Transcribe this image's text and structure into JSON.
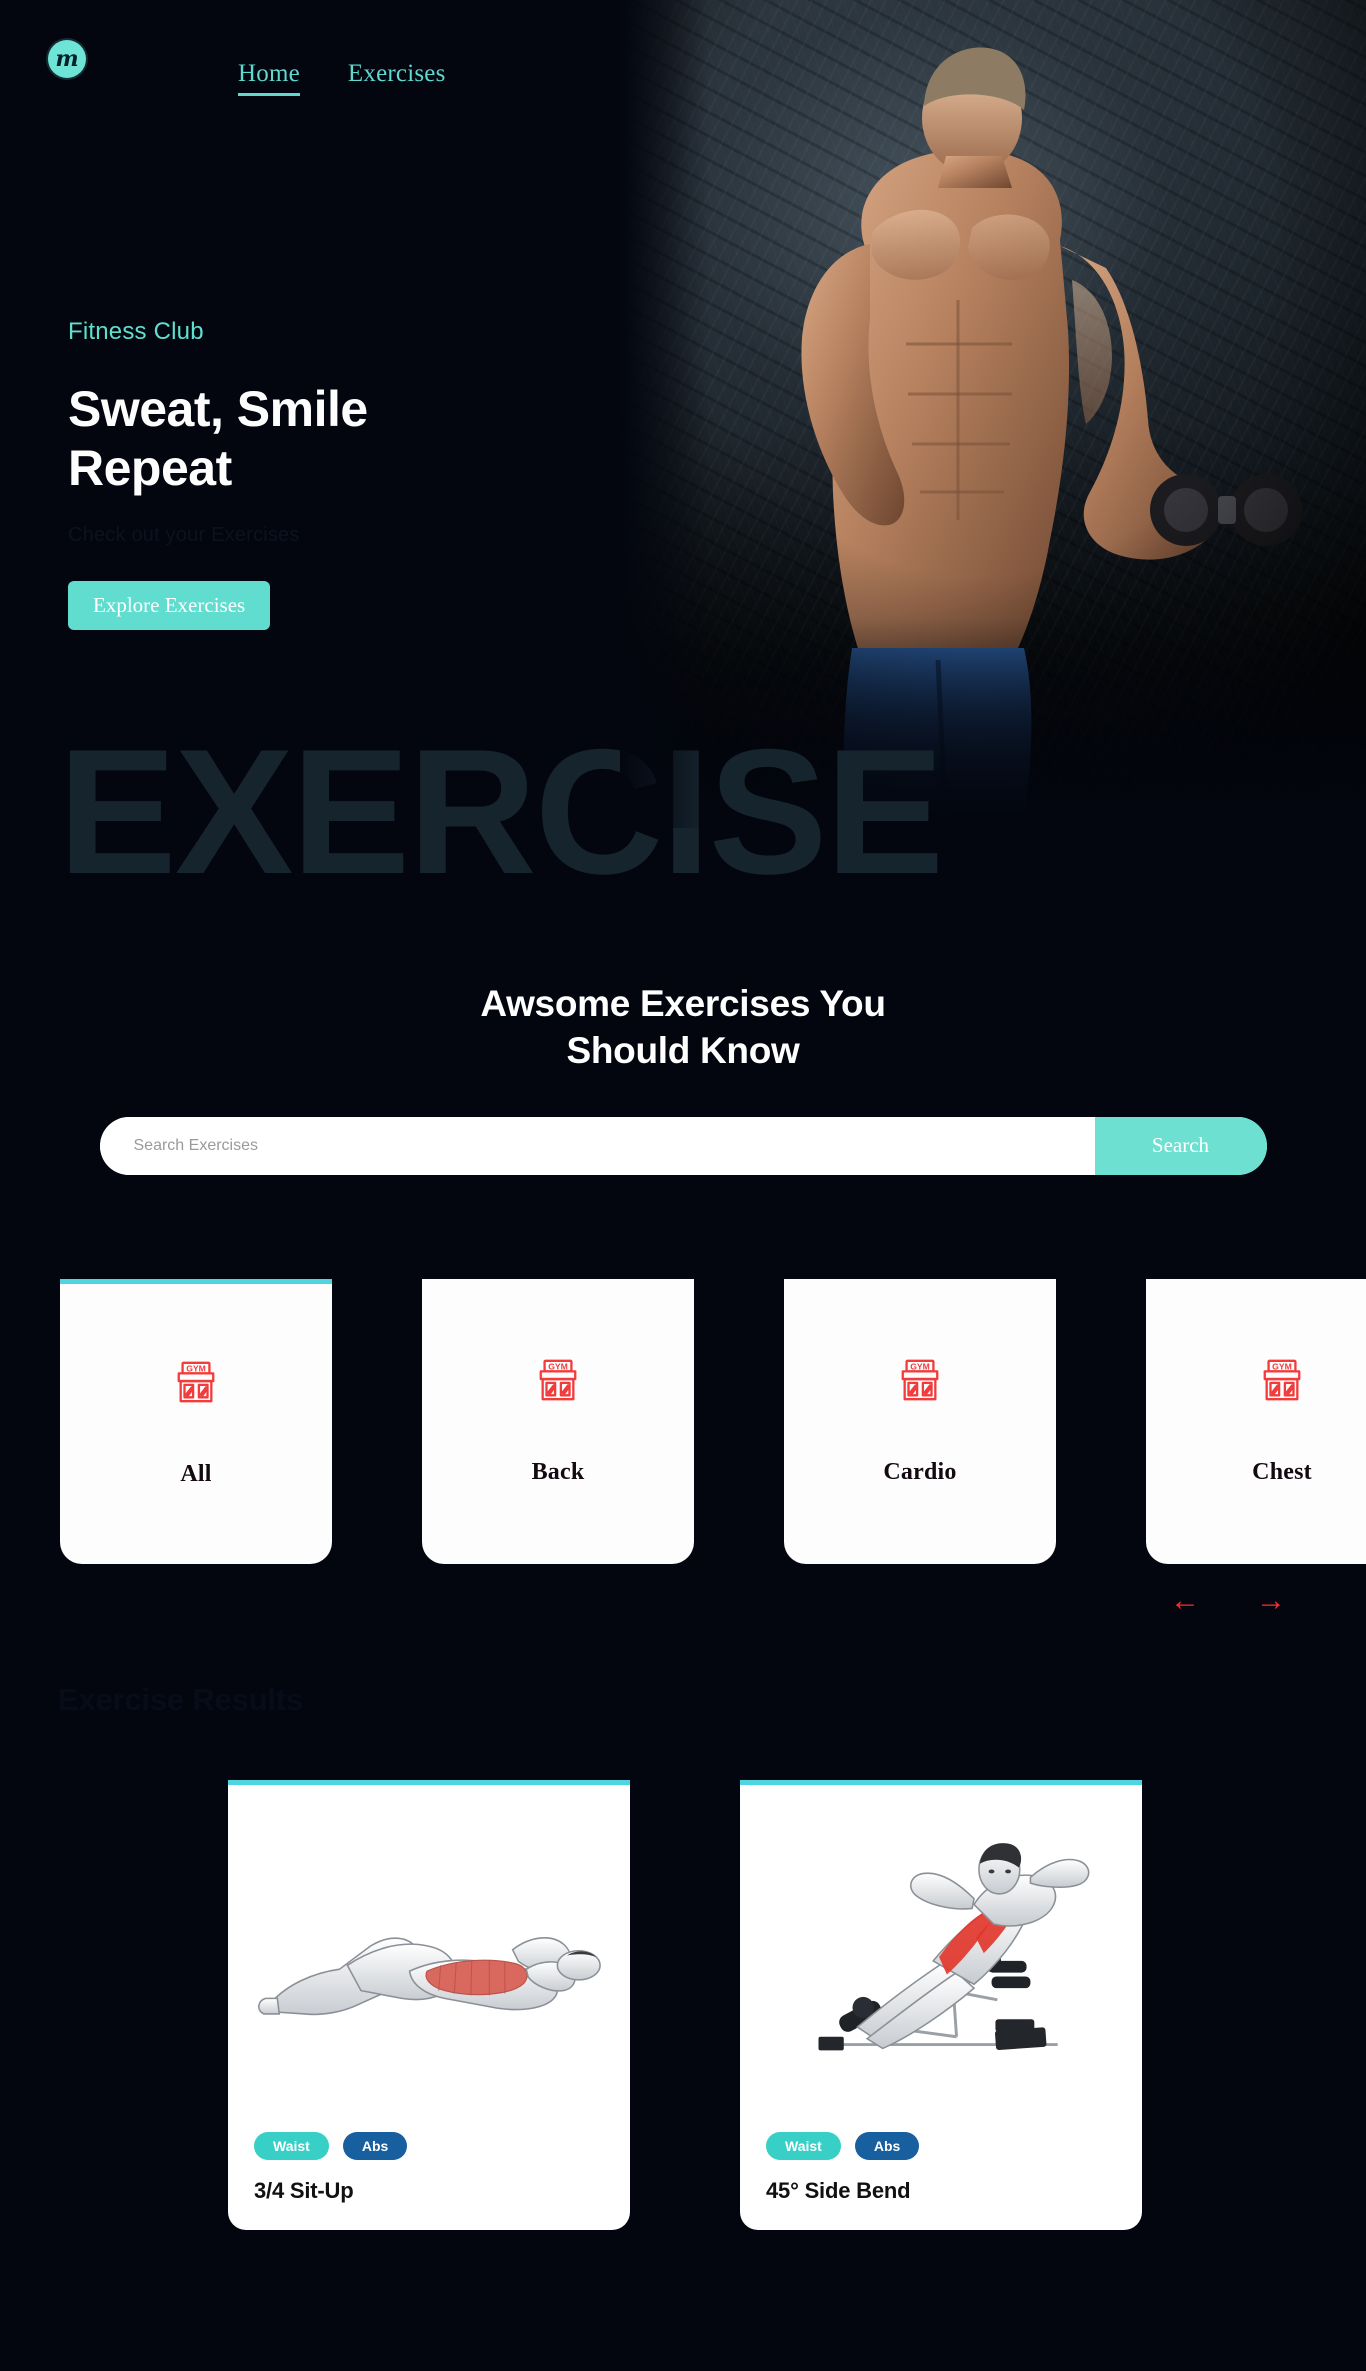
{
  "brand": {
    "logo_letter": "m",
    "logo_color": "#6ee4d6"
  },
  "nav": {
    "items": [
      {
        "label": "Home",
        "active": true
      },
      {
        "label": "Exercises",
        "active": false
      }
    ]
  },
  "hero": {
    "eyebrow": "Fitness Club",
    "title_line1": "Sweat, Smile",
    "title_line2": "Repeat",
    "subtitle": "Check out your Exercises",
    "cta_label": "Explore Exercises",
    "watermark": "EXERCISE",
    "accent_color": "#5fe0cf"
  },
  "exercises_section": {
    "heading_line1": "Awsome Exercises You",
    "heading_line2": "Should Know",
    "search": {
      "placeholder": "Search Exercises",
      "value": "",
      "button_label": "Search"
    },
    "categories": [
      {
        "label": "All",
        "icon": "gym-building-icon",
        "active": true
      },
      {
        "label": "Back",
        "icon": "gym-building-icon",
        "active": false
      },
      {
        "label": "Cardio",
        "icon": "gym-building-icon",
        "active": false
      },
      {
        "label": "Chest",
        "icon": "gym-building-icon",
        "active": false
      }
    ],
    "carousel": {
      "prev_icon": "arrow-left-icon",
      "next_icon": "arrow-right-icon",
      "arrow_color": "#ff2d2d"
    },
    "results_heading": "Exercise Results",
    "results": [
      {
        "name": "3/4 Sit-Up",
        "image": "situp-illustration",
        "tags": [
          {
            "label": "Waist",
            "color": "#38d0c6"
          },
          {
            "label": "Abs",
            "color": "#175f9e"
          }
        ]
      },
      {
        "name": "45° Side Bend",
        "image": "side-bend-bench-illustration",
        "tags": [
          {
            "label": "Waist",
            "color": "#38d0c6"
          },
          {
            "label": "Abs",
            "color": "#175f9e"
          }
        ]
      }
    ]
  }
}
